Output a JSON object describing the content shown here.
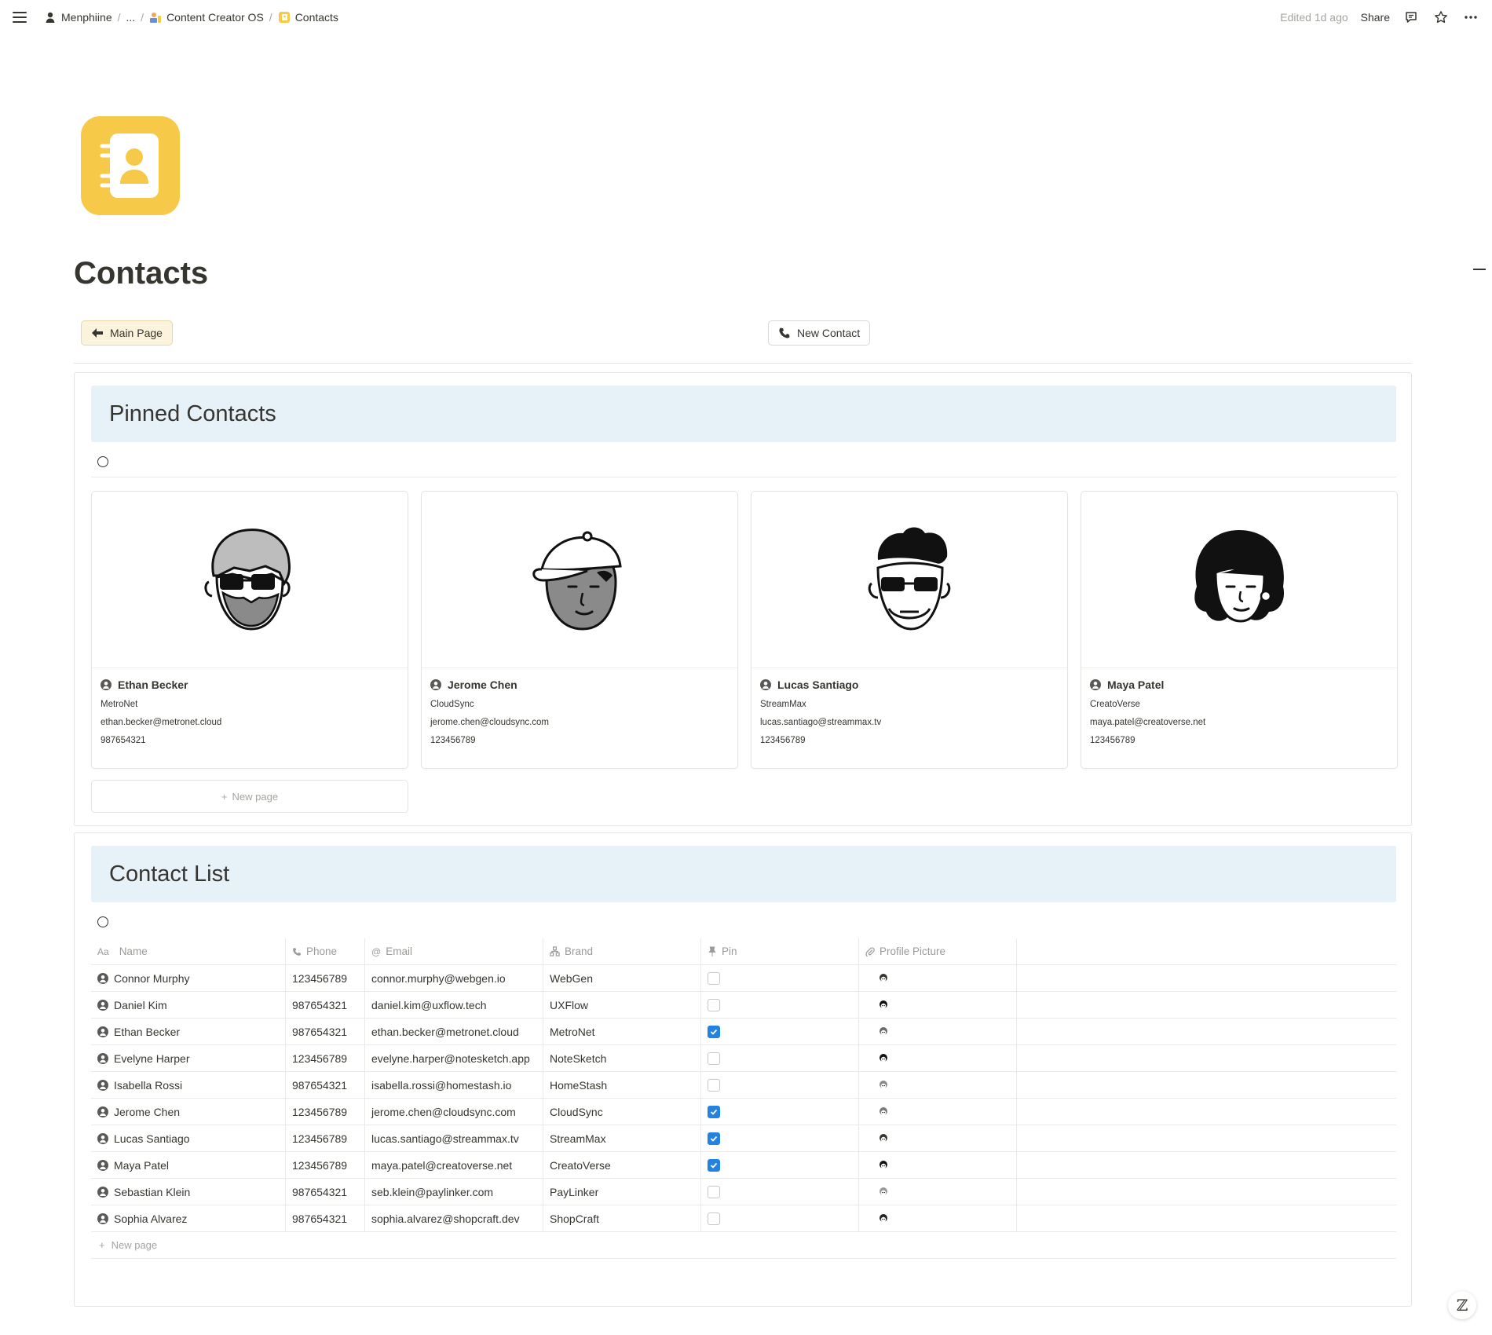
{
  "breadcrumb": {
    "workspace": "Menphiine",
    "ellipsis": "...",
    "parent": "Content Creator OS",
    "current": "Contacts"
  },
  "topbar": {
    "edited": "Edited 1d ago",
    "share": "Share"
  },
  "page": {
    "title": "Contacts"
  },
  "buttons": {
    "main_page": "Main Page",
    "new_contact": "New Contact"
  },
  "pinned": {
    "heading": "Pinned Contacts",
    "new_page": "New page",
    "cards": [
      {
        "name": "Ethan Becker",
        "brand": "MetroNet",
        "email": "ethan.becker@metronet.cloud",
        "phone": "987654321"
      },
      {
        "name": "Jerome Chen",
        "brand": "CloudSync",
        "email": "jerome.chen@cloudsync.com",
        "phone": "123456789"
      },
      {
        "name": "Lucas Santiago",
        "brand": "StreamMax",
        "email": "lucas.santiago@streammax.tv",
        "phone": "123456789"
      },
      {
        "name": "Maya Patel",
        "brand": "CreatoVerse",
        "email": "maya.patel@creatoverse.net",
        "phone": "123456789"
      }
    ]
  },
  "contact_list": {
    "heading": "Contact List",
    "columns": {
      "name_prefix": "Aa",
      "name": "Name",
      "phone": "Phone",
      "email": "Email",
      "brand": "Brand",
      "pin": "Pin",
      "picture": "Profile Picture"
    },
    "rows": [
      {
        "name": "Connor Murphy",
        "phone": "123456789",
        "email": "connor.murphy@webgen.io",
        "brand": "WebGen",
        "pin": false
      },
      {
        "name": "Daniel Kim",
        "phone": "987654321",
        "email": "daniel.kim@uxflow.tech",
        "brand": "UXFlow",
        "pin": false
      },
      {
        "name": "Ethan Becker",
        "phone": "987654321",
        "email": "ethan.becker@metronet.cloud",
        "brand": "MetroNet",
        "pin": true
      },
      {
        "name": "Evelyne Harper",
        "phone": "123456789",
        "email": "evelyne.harper@notesketch.app",
        "brand": "NoteSketch",
        "pin": false
      },
      {
        "name": "Isabella Rossi",
        "phone": "987654321",
        "email": "isabella.rossi@homestash.io",
        "brand": "HomeStash",
        "pin": false
      },
      {
        "name": "Jerome Chen",
        "phone": "123456789",
        "email": "jerome.chen@cloudsync.com",
        "brand": "CloudSync",
        "pin": true
      },
      {
        "name": "Lucas Santiago",
        "phone": "123456789",
        "email": "lucas.santiago@streammax.tv",
        "brand": "StreamMax",
        "pin": true
      },
      {
        "name": "Maya Patel",
        "phone": "123456789",
        "email": "maya.patel@creatoverse.net",
        "brand": "CreatoVerse",
        "pin": true
      },
      {
        "name": "Sebastian Klein",
        "phone": "987654321",
        "email": "seb.klein@paylinker.com",
        "brand": "PayLinker",
        "pin": false
      },
      {
        "name": "Sophia Alvarez",
        "phone": "987654321",
        "email": "sophia.alvarez@shopcraft.dev",
        "brand": "ShopCraft",
        "pin": false
      }
    ],
    "new_page": "New page"
  },
  "colors": {
    "accent_yellow": "#f7c948",
    "section_header_bg": "#e7f1f8",
    "checkbox_blue": "#2383e2",
    "main_button_bg": "#fbf3db"
  },
  "icons": {
    "menu": "hamburger-icon",
    "contacts_page": "address-book-icon",
    "back": "arrow-left-icon",
    "phone": "phone-icon",
    "person": "person-circle-icon",
    "comment": "comment-icon",
    "favorite": "star-icon",
    "more": "ellipsis-icon",
    "help": "notion-ai-icon"
  }
}
